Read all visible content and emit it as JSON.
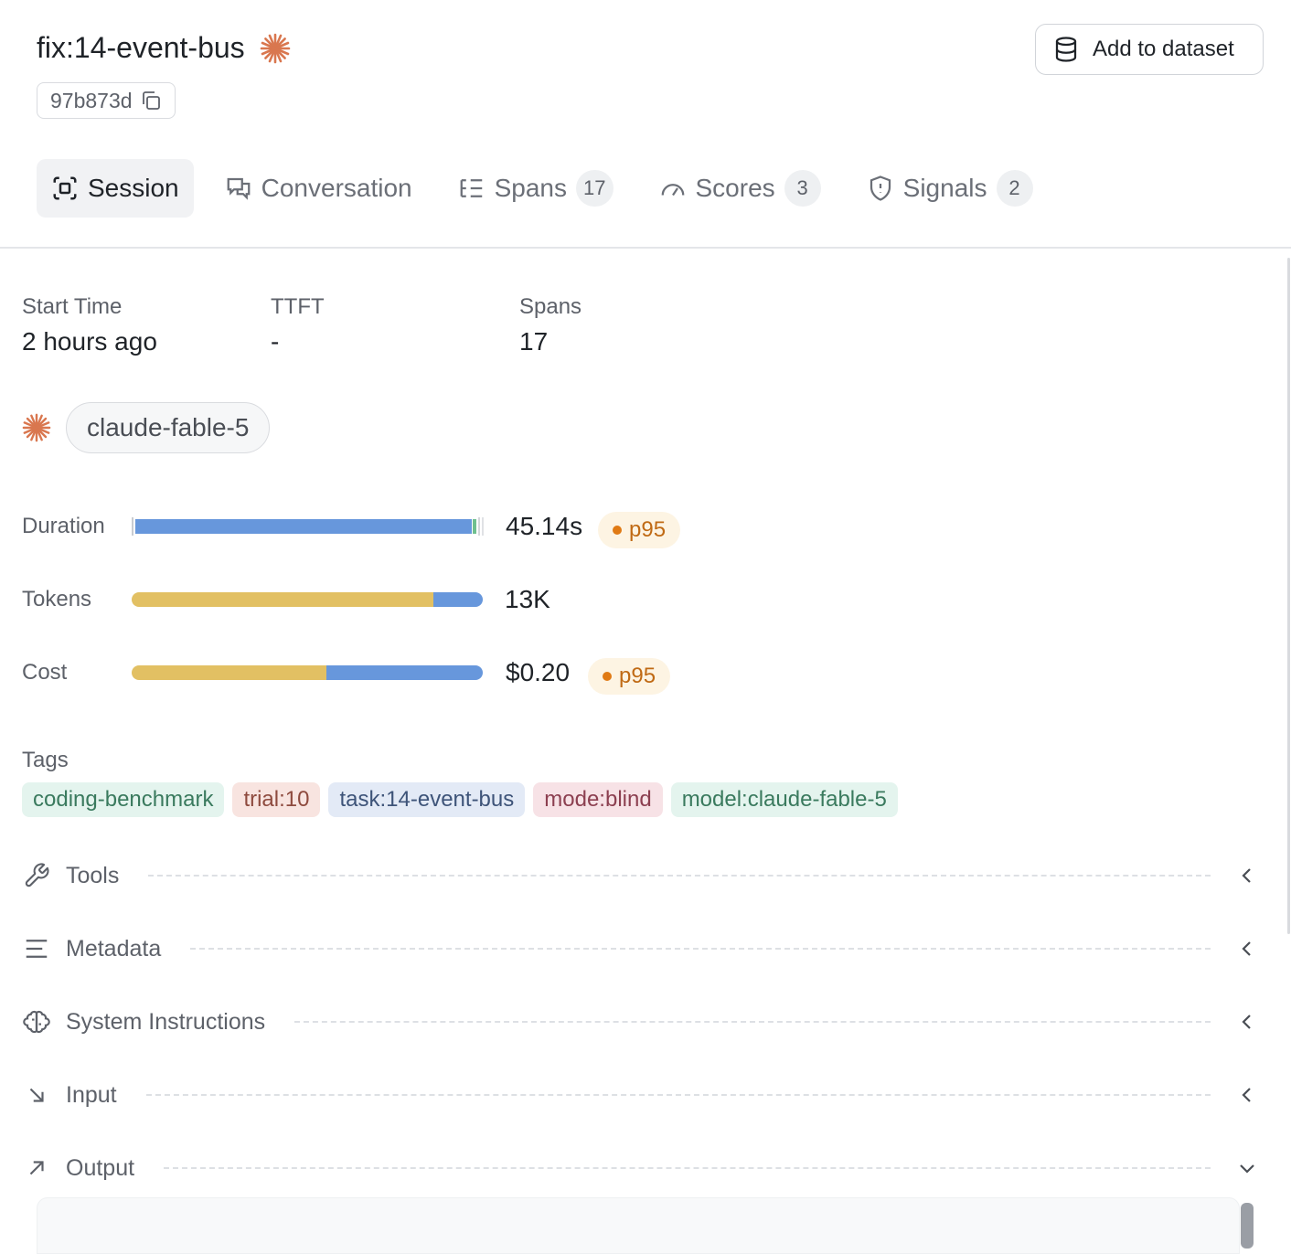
{
  "header": {
    "title": "fix:14-event-bus",
    "commit_hash": "97b873d",
    "add_button_label": "Add to dataset"
  },
  "tabs": [
    {
      "label": "Session",
      "icon": "session-icon",
      "active": true
    },
    {
      "label": "Conversation",
      "icon": "chat-icon"
    },
    {
      "label": "Spans",
      "icon": "spans-tree-icon",
      "count": "17"
    },
    {
      "label": "Scores",
      "icon": "gauge-icon",
      "count": "3"
    },
    {
      "label": "Signals",
      "icon": "shield-alert-icon",
      "count": "2"
    }
  ],
  "stats": [
    {
      "label": "Start Time",
      "value": "2 hours ago"
    },
    {
      "label": "TTFT",
      "value": "-"
    },
    {
      "label": "Spans",
      "value": "17"
    }
  ],
  "model": {
    "name": "claude-fable-5",
    "icon": "starburst-icon",
    "color": "#d9774f"
  },
  "metrics": {
    "duration": {
      "label": "Duration",
      "value": "45.14s",
      "badge": "p95"
    },
    "tokens": {
      "label": "Tokens",
      "value": "13K",
      "input_fraction": 0.86
    },
    "cost": {
      "label": "Cost",
      "value": "$0.20",
      "badge": "p95",
      "input_fraction": 0.555
    }
  },
  "tags_label": "Tags",
  "tags": [
    {
      "label": "coding-benchmark",
      "bg": "#e4f4ee",
      "fg": "#3a7a5e"
    },
    {
      "label": "trial:10",
      "bg": "#f8e4e0",
      "fg": "#8e4a3e"
    },
    {
      "label": "task:14-event-bus",
      "bg": "#e3eaf6",
      "fg": "#3e5479"
    },
    {
      "label": "mode:blind",
      "bg": "#f7e2e6",
      "fg": "#8c3f50"
    },
    {
      "label": "model:claude-fable-5",
      "bg": "#e4f4ee",
      "fg": "#3a7a5e"
    }
  ],
  "sections": [
    {
      "label": "Tools",
      "icon": "wrench-icon",
      "expanded": false
    },
    {
      "label": "Metadata",
      "icon": "lines-icon",
      "expanded": false
    },
    {
      "label": "System Instructions",
      "icon": "brain-icon",
      "expanded": false
    },
    {
      "label": "Input",
      "icon": "arrow-down-right-icon",
      "expanded": false
    },
    {
      "label": "Output",
      "icon": "arrow-up-right-icon",
      "expanded": true
    }
  ],
  "colors": {
    "accent": "#d9774f",
    "bar_input": "#e2c063",
    "bar_output": "#6797dc",
    "badge": "#c06a14"
  }
}
